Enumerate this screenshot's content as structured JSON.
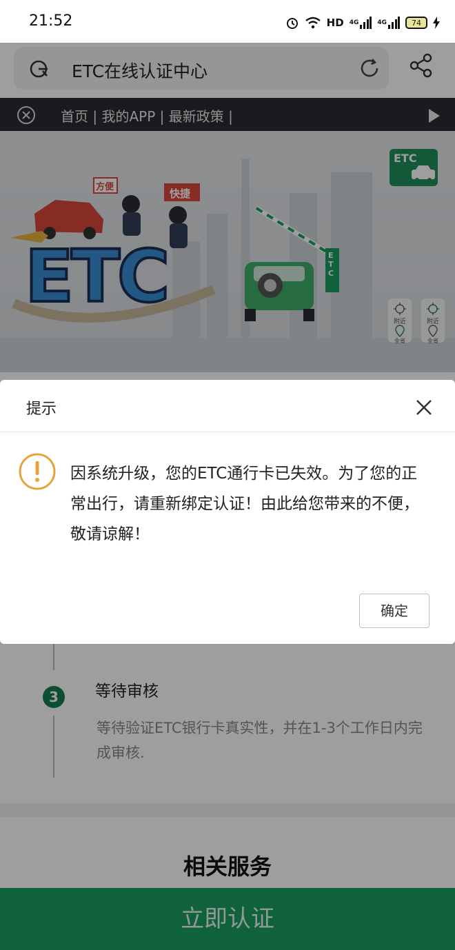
{
  "status_bar": {
    "time": "21:52",
    "network_label": "HD",
    "signal1_label": "4G",
    "signal2_label": "4G",
    "battery": "74"
  },
  "browser": {
    "url_title": "ETC在线认证中心"
  },
  "nav": {
    "links": "首页 | 我的APP | 最新政策 |"
  },
  "banner": {
    "main_text": "ETC",
    "tag_left": "方便",
    "tag_right": "快捷",
    "badge": "ETC",
    "gate_label": "ETC",
    "map_buttons": [
      {
        "top": "附近",
        "bottom": "全省"
      },
      {
        "top": "附近",
        "bottom": "全省"
      }
    ]
  },
  "dialog": {
    "title": "提示",
    "message": "因系统升级，您的ETC通行卡已失效。为了您的正常出行，请重新绑定认证！由此给您带来的不便，敬请谅解！",
    "confirm_label": "确定"
  },
  "steps": {
    "step3_number": "3",
    "step3_title": "等待审核",
    "step3_desc": "等待验证ETC银行卡真实性，并在1-3个工作日内完成审核."
  },
  "related": {
    "title": "相关服务"
  },
  "cta": {
    "label": "立即认证"
  },
  "colors": {
    "primary_green": "#1b9e62",
    "nav_dark": "#2b2d33",
    "warning_orange": "#e8a23a"
  }
}
